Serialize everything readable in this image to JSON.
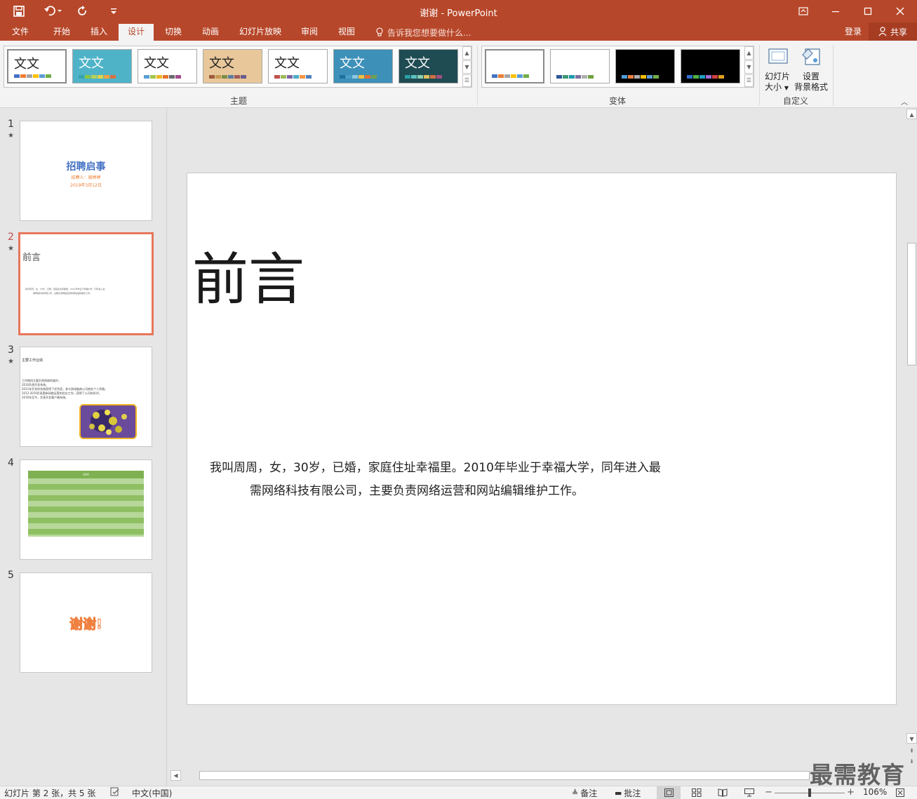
{
  "window": {
    "title": "谢谢 - PowerPoint",
    "controls": [
      "restore-ribbon-icon",
      "minimize-icon",
      "maximize-icon",
      "close-icon"
    ]
  },
  "quick_access": {
    "items": [
      "save-icon",
      "undo-icon",
      "redo-icon",
      "customize-icon"
    ]
  },
  "tabs": {
    "items": [
      {
        "label": "文件"
      },
      {
        "label": "开始"
      },
      {
        "label": "插入"
      },
      {
        "label": "设计"
      },
      {
        "label": "切换"
      },
      {
        "label": "动画"
      },
      {
        "label": "幻灯片放映"
      },
      {
        "label": "审阅"
      },
      {
        "label": "视图"
      }
    ],
    "active_index": 3,
    "tell_me": "告诉我您想要做什么...",
    "login": "登录",
    "share": "共享"
  },
  "ribbon": {
    "themes": {
      "label": "主题",
      "items": [
        {
          "text": "文文",
          "bg": "#ffffff",
          "swatches": [
            "#4472c4",
            "#ed7d31",
            "#a5a5a5",
            "#ffc000",
            "#5b9bd5",
            "#70ad47"
          ]
        },
        {
          "text": "文文",
          "bg": "#4fb3c8",
          "swatches": [
            "#38a4b0",
            "#8cc53f",
            "#b7d157",
            "#e3d34a",
            "#f0a33a",
            "#d97242"
          ]
        },
        {
          "text": "文文",
          "bg": "#ffffff",
          "swatches": [
            "#5aa0d6",
            "#a0c84c",
            "#f0b323",
            "#e5722a",
            "#6a6a6a",
            "#a24c8f"
          ]
        },
        {
          "text": "文文",
          "bg": "#e8c79a",
          "swatches": [
            "#9b5a3a",
            "#c49a52",
            "#7b8f4a",
            "#5a7ea0",
            "#a05a5a",
            "#6b5a8f"
          ]
        },
        {
          "text": "文文",
          "bg": "#ffffff",
          "swatches": [
            "#c0504d",
            "#9bbb59",
            "#8064a2",
            "#4bacc6",
            "#f79646",
            "#4f81bd"
          ]
        },
        {
          "text": "文文",
          "bg": "#3d90b8",
          "swatches": [
            "#1f6f9f",
            "#4aa0c8",
            "#8ec8e0",
            "#f0c040",
            "#e07030",
            "#70a050"
          ]
        },
        {
          "text": "文文",
          "bg": "#1f4b52",
          "swatches": [
            "#2aa0a8",
            "#5ec0c0",
            "#8ad0b0",
            "#e0c060",
            "#d07040",
            "#a05080"
          ]
        }
      ]
    },
    "variants": {
      "label": "变体",
      "items": [
        {
          "bg": "#ffffff",
          "swatches": [
            "#4472c4",
            "#ed7d31",
            "#a5a5a5",
            "#ffc000",
            "#5b9bd5",
            "#70ad47"
          ]
        },
        {
          "bg": "#ffffff",
          "swatches": [
            "#2f5597",
            "#3d9970",
            "#1f9bb0",
            "#7f6f9f",
            "#b0b0b0",
            "#6fa040"
          ]
        },
        {
          "bg": "#000000",
          "swatches": [
            "#4f9bd9",
            "#f08040",
            "#b0b0b0",
            "#ffc000",
            "#5b9bd5",
            "#70ad47"
          ]
        },
        {
          "bg": "#000000",
          "swatches": [
            "#2f6fd0",
            "#4fb040",
            "#1fa0c0",
            "#9f6fcf",
            "#d04040",
            "#e0a020"
          ]
        }
      ]
    },
    "customize": {
      "label": "自定义",
      "slide_size_line1": "幻灯片",
      "slide_size_line2": "大小",
      "format_bg_line1": "设置",
      "format_bg_line2": "背景格式"
    }
  },
  "slides": [
    {
      "num": "1",
      "title": "招聘启事",
      "sub1": "招聘人：周婷婷",
      "sub2": "2019年3月12日"
    },
    {
      "num": "2",
      "title": "前言",
      "line1": "我叫周周，女，30岁，已婚，家庭住址幸福里。2010年毕业于幸福大学，同年进入最",
      "line2": "需网络科技有限公司，主要负责网络运营和网站编辑维护工作。"
    },
    {
      "num": "3",
      "title": "主要工作业绩",
      "lines": [
        "工作期间主要负责网络的维护。",
        "2010负责开发系统。",
        "2011年开发的系统获得了优秀奖，参与到电脑商公司商务个人资格。",
        "2012-2016负责更新网络运营的优化工作，获得了公司的好评。",
        "2016年至今，负责开发客户端系统。"
      ]
    },
    {
      "num": "4",
      "table_title": "业绩表"
    },
    {
      "num": "5",
      "title": "谢谢!"
    }
  ],
  "current_slide": {
    "title": "前言",
    "body_line1": "我叫周周，女，30岁，已婚，家庭住址幸福里。2010年毕业于幸福大学，同年进入最",
    "body_line2": "需网络科技有限公司，主要负责网络运营和网站编辑维护工作。"
  },
  "statusbar": {
    "slide_info": "幻灯片 第 2 张，共 5 张",
    "language": "中文(中国)",
    "notes": "备注",
    "comments": "批注",
    "zoom": "106%"
  },
  "watermark": "最需教育",
  "colors": {
    "accent": "#b7472a",
    "selected_border": "#e8765a"
  }
}
